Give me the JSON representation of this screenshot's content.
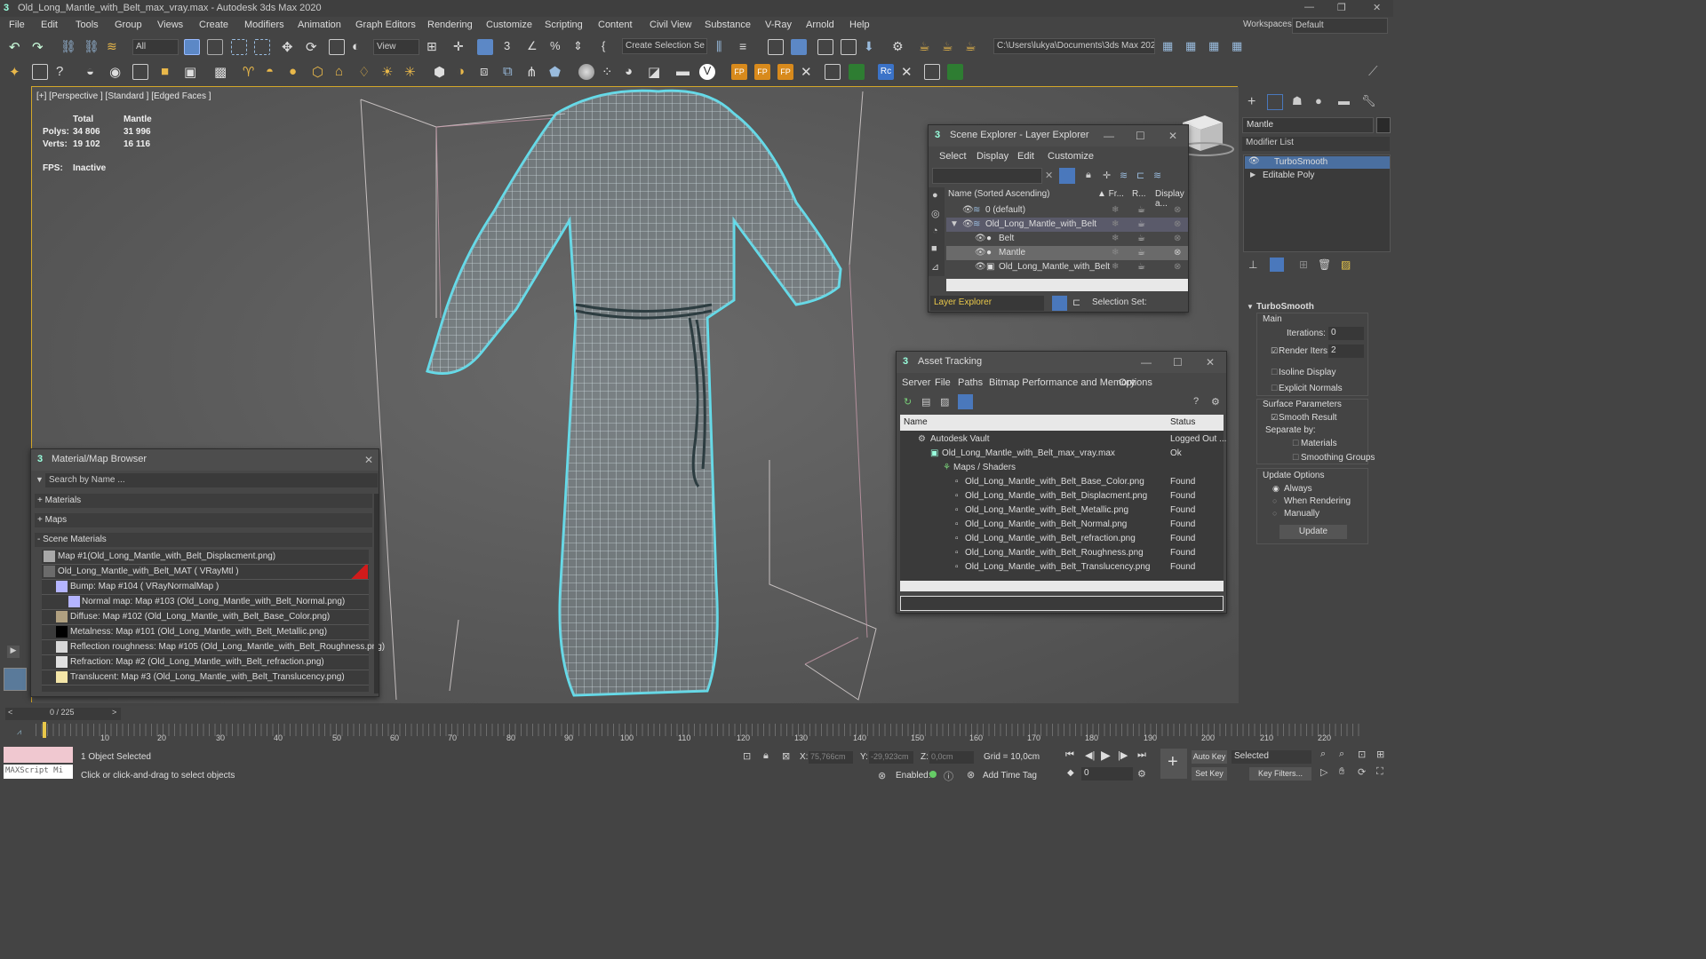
{
  "window": {
    "title": "Old_Long_Mantle_with_Belt_max_vray.max - Autodesk 3ds Max 2020"
  },
  "menu": [
    "File",
    "Edit",
    "Tools",
    "Group",
    "Views",
    "Create",
    "Modifiers",
    "Animation",
    "Graph Editors",
    "Rendering",
    "Customize",
    "Scripting",
    "Content",
    "Civil View",
    "Substance",
    "V-Ray",
    "Arnold",
    "Help"
  ],
  "workspace": {
    "label": "Workspaces:",
    "value": "Default"
  },
  "toolbar": {
    "filter": "All",
    "refcoord": "View",
    "selection_set": "Create Selection Se",
    "project_path": "C:\\Users\\lukya\\Documents\\3ds Max 2022"
  },
  "viewport": {
    "label": "[+] [Perspective ] [Standard ] [Edged Faces ]",
    "stats": {
      "col_total": "Total",
      "col_mantle": "Mantle",
      "polys_label": "Polys:",
      "polys_total": "34 806",
      "polys_mantle": "31 996",
      "verts_label": "Verts:",
      "verts_total": "19 102",
      "verts_mantle": "16 116",
      "fps_label": "FPS:",
      "fps_value": "Inactive"
    }
  },
  "scene_explorer": {
    "title": "Scene Explorer - Layer Explorer",
    "menu": [
      "Select",
      "Display",
      "Edit",
      "Customize"
    ],
    "columns": {
      "name": "Name (Sorted Ascending)",
      "frozen": "▲ Fr...",
      "render": "R...",
      "display": "Display a..."
    },
    "rows": [
      "0 (default)",
      "Old_Long_Mantle_with_Belt",
      "Belt",
      "Mantle",
      "Old_Long_Mantle_with_Belt"
    ],
    "footer_layer": "Layer Explorer",
    "footer_selset": "Selection Set:"
  },
  "asset_tracking": {
    "title": "Asset Tracking",
    "menu": [
      "Server",
      "File",
      "Paths",
      "Bitmap Performance and Memory",
      "Options"
    ],
    "col_name": "Name",
    "col_status": "Status",
    "rows": [
      {
        "name": "Autodesk Vault",
        "status": "Logged Out ..."
      },
      {
        "name": "Old_Long_Mantle_with_Belt_max_vray.max",
        "status": "Ok"
      },
      {
        "name": "Maps / Shaders",
        "status": ""
      },
      {
        "name": "Old_Long_Mantle_with_Belt_Base_Color.png",
        "status": "Found"
      },
      {
        "name": "Old_Long_Mantle_with_Belt_Displacment.png",
        "status": "Found"
      },
      {
        "name": "Old_Long_Mantle_with_Belt_Metallic.png",
        "status": "Found"
      },
      {
        "name": "Old_Long_Mantle_with_Belt_Normal.png",
        "status": "Found"
      },
      {
        "name": "Old_Long_Mantle_with_Belt_refraction.png",
        "status": "Found"
      },
      {
        "name": "Old_Long_Mantle_with_Belt_Roughness.png",
        "status": "Found"
      },
      {
        "name": "Old_Long_Mantle_with_Belt_Translucency.png",
        "status": "Found"
      }
    ]
  },
  "material_browser": {
    "title": "Material/Map Browser",
    "search_placeholder": "Search by Name ...",
    "groups": [
      "+ Materials",
      "+ Maps",
      "- Scene Materials"
    ],
    "items": [
      "Map #1(Old_Long_Mantle_with_Belt_Displacment.png)",
      "Old_Long_Mantle_with_Belt_MAT  ( VRayMtl )",
      "Bump: Map #104  ( VRayNormalMap )",
      "Normal map: Map #103 (Old_Long_Mantle_with_Belt_Normal.png)",
      "Diffuse: Map #102 (Old_Long_Mantle_with_Belt_Base_Color.png)",
      "Metalness: Map #101 (Old_Long_Mantle_with_Belt_Metallic.png)",
      "Reflection roughness: Map #105 (Old_Long_Mantle_with_Belt_Roughness.png)",
      "Refraction: Map #2 (Old_Long_Mantle_with_Belt_refraction.png)",
      "Translucent: Map #3 (Old_Long_Mantle_with_Belt_Translucency.png)"
    ],
    "swatch_colors": [
      "#a8a8a8",
      "#6b6b6b",
      "#b4b4ff",
      "#b4b4ff",
      "#b0a080",
      "#000000",
      "#d8d8d8",
      "#e0e0e0",
      "#f4e6a8"
    ]
  },
  "command_panel": {
    "object_name": "Mantle",
    "modifier_list": "Modifier List",
    "stack": [
      "TurboSmooth",
      "Editable Poly"
    ],
    "rollout_title": "TurboSmooth",
    "main_label": "Main",
    "iterations_label": "Iterations:",
    "iterations_value": "0",
    "render_iters_label": "Render Iters:",
    "render_iters_value": "2",
    "isoline": "Isoline Display",
    "explicit_normals": "Explicit Normals",
    "surface_params": "Surface Parameters",
    "smooth_result": "Smooth Result",
    "separate_by": "Separate by:",
    "materials": "Materials",
    "smoothing_groups": "Smoothing Groups",
    "update_options": "Update Options",
    "always": "Always",
    "when_rendering": "When Rendering",
    "manually": "Manually",
    "update_button": "Update"
  },
  "timeline": {
    "frame": "0 / 225",
    "ticks": [
      "10",
      "20",
      "30",
      "40",
      "50",
      "60",
      "70",
      "80",
      "90",
      "100",
      "110",
      "120",
      "130",
      "140",
      "150",
      "160",
      "170",
      "180",
      "190",
      "200",
      "210",
      "220"
    ]
  },
  "status": {
    "maxscript": "MAXScript Mi",
    "selected": "1 Object Selected",
    "hint": "Click or click-and-drag to select objects",
    "x_label": "X:",
    "x_value": "75,766cm",
    "y_label": "Y:",
    "y_value": "-29,923cm",
    "z_label": "Z:",
    "z_value": "0,0cm",
    "grid": "Grid = 10,0cm",
    "enabled": "Enabled:",
    "add_time_tag": "Add Time Tag",
    "autokey": "Auto Key",
    "selected_dd": "Selected",
    "setkey": "Set Key",
    "keyfilters": "Key Filters...",
    "frame_spinner": "0"
  }
}
